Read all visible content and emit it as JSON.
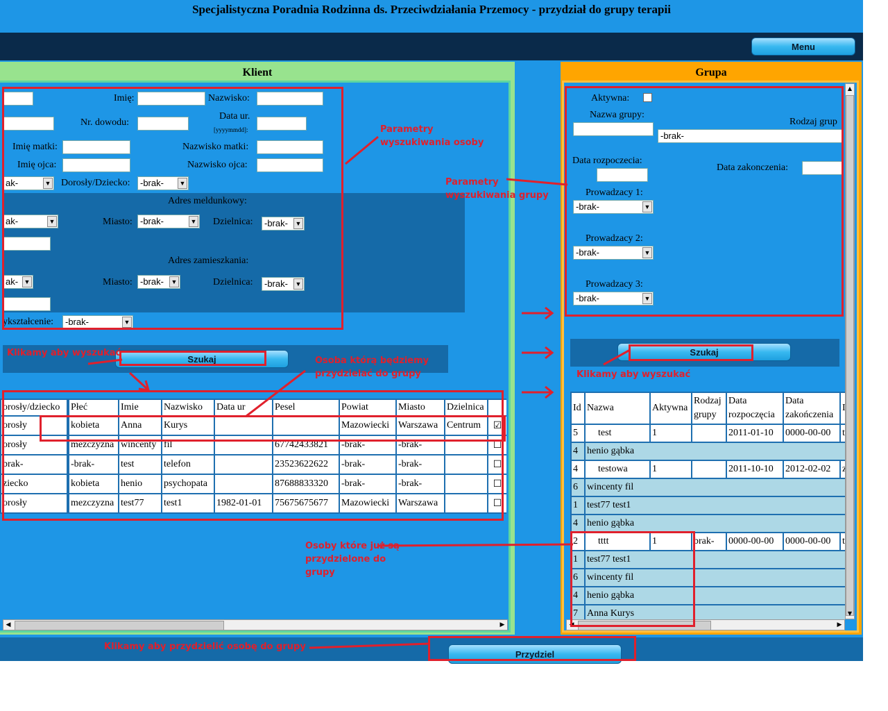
{
  "header": {
    "title": "Specjalistyczna Poradnia Rodzinna ds. Przeciwdziałania Przemocy - przydział do grupy terapii"
  },
  "nav": {
    "menu_label": "Menu"
  },
  "klient": {
    "title": "Klient",
    "imie_label": "Imię:",
    "nazwisko_label": "Nazwisko:",
    "nr_dowodu_label": "Nr. dowodu:",
    "data_ur_label": "Data ur.",
    "data_ur_format": "[yyyymmdd]:",
    "imie_matki_label": "Imię matki:",
    "nazwisko_matki_label": "Nazwisko matki:",
    "imie_ojca_label": "Imię ojca:",
    "nazwisko_ojca_label": "Nazwisko ojca:",
    "plec_value": "ak-",
    "dorosly_label": "Dorosły/Dziecko:",
    "dorosly_value": "-brak-",
    "adres_meld_label": "Adres meldunkowy:",
    "meld_woj_value": "ak-",
    "miasto_label": "Miasto:",
    "meld_miasto_value": "-brak-",
    "dzielnica_label": "Dzielnica:",
    "meld_dzielnica_value": "-brak-",
    "adres_zam_label": "Adres zamieszkania:",
    "zam_woj_value": "ak-",
    "zam_miasto_value": "-brak-",
    "zam_dzielnica_value": "-brak-",
    "wyksztalcenie_label": "ykształcenie:",
    "wyksztalcenie_value": "-brak-",
    "search_button": "Szukaj",
    "table": {
      "headers": [
        "orosły/dziecko",
        "",
        "Płeć",
        "Imie",
        "Nazwisko",
        "Data ur",
        "Pesel",
        "Powiat",
        "Miasto",
        "Dzielnica",
        ""
      ],
      "rows": [
        [
          "orosły",
          "",
          "kobieta",
          "Anna",
          "Kurys",
          "",
          "",
          "Mazowiecki",
          "Warszawa",
          "Centrum",
          "☑"
        ],
        [
          "orosły",
          "",
          "mezczyzna",
          "wincenty",
          "fil",
          "",
          "67742433821",
          "-brak-",
          "-brak-",
          "",
          "☐"
        ],
        [
          "brak-",
          "",
          "-brak-",
          "test",
          "telefon",
          "",
          "23523622622",
          "-brak-",
          "-brak-",
          "",
          "☐"
        ],
        [
          "ziecko",
          "",
          "kobieta",
          "henio",
          "psychopata",
          "",
          "87688833320",
          "-brak-",
          "-brak-",
          "",
          "☐"
        ],
        [
          "orosły",
          "",
          "mezczyzna",
          "test77",
          "test1",
          "1982-01-01",
          "75675675677",
          "Mazowiecki",
          "Warszawa",
          "",
          "☐"
        ]
      ]
    }
  },
  "grupa": {
    "title": "Grupa",
    "aktywna_label": "Aktywna:",
    "nazwa_label": "Nazwa grupy:",
    "rodzaj_label": "Rodzaj grup",
    "rodzaj_value": "-brak-",
    "data_rozp_label": "Data rozpoczecia:",
    "data_zak_label": "Data zakonczenia:",
    "prow1_label": "Prowadzacy 1:",
    "prow1_value": "-brak-",
    "prow2_label": "Prowadzacy 2:",
    "prow2_value": "-brak-",
    "prow3_label": "Prowadzacy 3:",
    "prow3_value": "-brak-",
    "search_button": "Szukaj",
    "table": {
      "headers": [
        "Id",
        "Nazwa",
        "Aktywna",
        "Rodzaj grupy",
        "Data rozpoczęcia",
        "Data zakończenia",
        "I"
      ],
      "group_rows": [
        {
          "id": "5",
          "nazwa": "test",
          "aktywna": "1",
          "rodzaj": "",
          "start": "2011-01-10",
          "end": "0000-00-00",
          "x": "t"
        },
        {
          "id": "4",
          "nazwa": "henio gąbka",
          "member": true
        },
        {
          "id": "4",
          "nazwa": "testowa",
          "aktywna": "1",
          "rodzaj": "",
          "start": "2011-10-10",
          "end": "2012-02-02",
          "x": "z"
        },
        {
          "id": "6",
          "nazwa": "wincenty fil",
          "member": true
        },
        {
          "id": "1",
          "nazwa": "test77 test1",
          "member": true
        },
        {
          "id": "4",
          "nazwa": "henio gąbka",
          "member": true
        },
        {
          "id": "2",
          "nazwa": "tttt",
          "aktywna": "1",
          "rodzaj": "brak-",
          "start": "0000-00-00",
          "end": "0000-00-00",
          "x": "t"
        },
        {
          "id": "1",
          "nazwa": "test77 test1",
          "member": true
        },
        {
          "id": "6",
          "nazwa": "wincenty fil",
          "member": true
        },
        {
          "id": "4",
          "nazwa": "henio gąbka",
          "member": true
        },
        {
          "id": "7",
          "nazwa": "Anna Kurys",
          "member": true
        }
      ]
    }
  },
  "footer": {
    "przydziel_button": "Przydziel"
  },
  "annotations": {
    "params_person": "Parametry wyszukiwania osoby",
    "params_group": "Parametry wyszukiwania grupy",
    "click_search_left": "Klikamy aby wyszukać",
    "click_search_right": "Klikamy aby wyszukać",
    "person_to_assign": "Osoba którą będziemy przydzielać do grupy",
    "already_assigned": "Osoby które już są przydzielone do grupy",
    "click_assign": "Klikamy aby przydzielić osobę do grupy"
  },
  "colors": {
    "background": "#1e96e6",
    "navbar": "#0a2a4a",
    "klient_header": "#98e38e",
    "grupa_header": "#ffa500",
    "annotation": "#e0202c",
    "member_row": "#add8e6"
  }
}
